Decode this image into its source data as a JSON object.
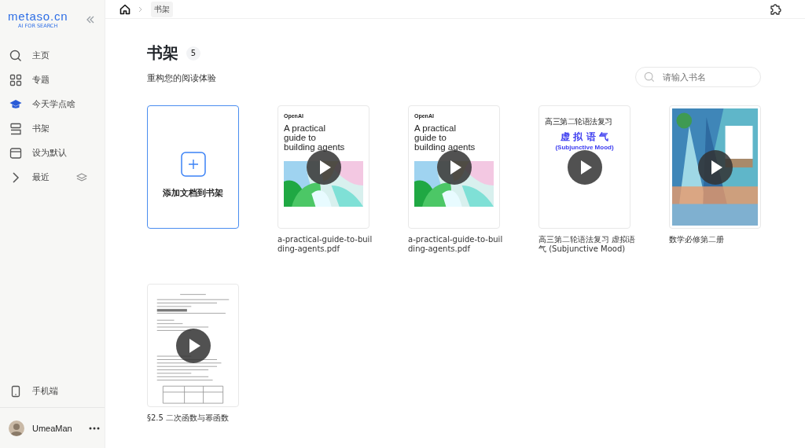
{
  "sidebar": {
    "logo": "metaso.cn",
    "tagline": "AI FOR SEARCH",
    "items": [
      {
        "label": "主页",
        "selected": false
      },
      {
        "label": "专题",
        "selected": false
      },
      {
        "label": "今天学点啥",
        "selected": false
      },
      {
        "label": "书架",
        "selected": false
      },
      {
        "label": "设为默认",
        "selected": false
      },
      {
        "label": "最近",
        "selected": false
      }
    ],
    "mobile": "手机端",
    "user": "UmeaMan"
  },
  "breadcrumb": [
    "书架"
  ],
  "page": {
    "title": "书架",
    "count": "5",
    "subtitle": "重构您的阅读体验",
    "search": {
      "placeholder": "请输入书名"
    },
    "add_label": "添加文档到书架"
  },
  "books": [
    {
      "kind": "guide",
      "cover": {
        "brand": "OpenAI",
        "title": "A practical guide to building agents"
      },
      "name": "a-practical-guide-to-building-agents.pdf"
    },
    {
      "kind": "guide",
      "cover": {
        "brand": "OpenAI",
        "title": "A practical guide to building agents"
      },
      "name": "a-practical-guide-to-building-agents.pdf"
    },
    {
      "kind": "notes",
      "cover": {
        "brand": "高三第二轮语法复习",
        "title": "虚 拟 语 气",
        "subtitle": "(Subjunctive Mood)"
      },
      "name": "高三第二轮语法复习 虚拟语气 (Subjunctive Mood)"
    },
    {
      "kind": "picture",
      "name": "数学必修第二册"
    },
    {
      "kind": "scan",
      "name": "§2.5 二次函数与幂函数"
    }
  ]
}
